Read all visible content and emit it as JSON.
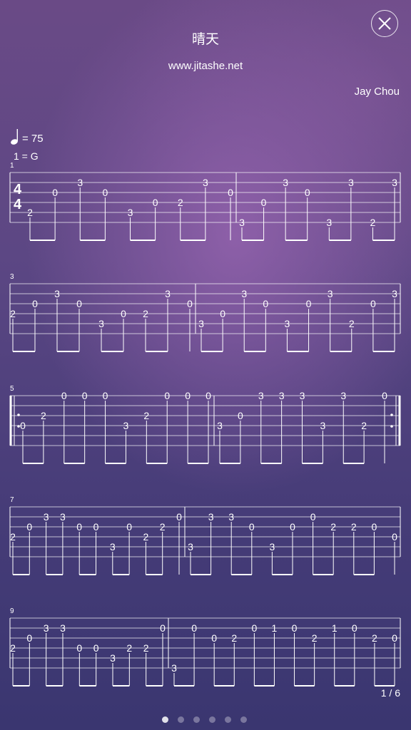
{
  "header": {
    "title": "晴天",
    "website": "www.jitashe.net",
    "artist": "Jay Chou",
    "close_icon": "close-icon"
  },
  "tempo": {
    "note_icon": "quarter-note-icon",
    "text": "= 75"
  },
  "key": {
    "text": "1 = G"
  },
  "time_signature": {
    "top": "4",
    "bottom": "4"
  },
  "systems": [
    {
      "label": "1",
      "measures": [
        {
          "notes": [
            {
              "s": 5,
              "f": "2"
            },
            {
              "s": 3,
              "f": "0"
            },
            {
              "s": 2,
              "f": "3"
            },
            {
              "s": 3,
              "f": "0"
            },
            {
              "s": 5,
              "f": "3"
            },
            {
              "s": 4,
              "f": "0"
            },
            {
              "s": 4,
              "f": "2"
            },
            {
              "s": 2,
              "f": "3"
            },
            {
              "s": 3,
              "f": "0"
            }
          ]
        },
        {
          "notes": [
            {
              "s": 6,
              "f": "3"
            },
            {
              "s": 4,
              "f": "0"
            },
            {
              "s": 2,
              "f": "3"
            },
            {
              "s": 3,
              "f": "0"
            },
            {
              "s": 6,
              "f": "3"
            },
            {
              "s": 2,
              "f": "3"
            },
            {
              "s": 6,
              "f": "2"
            },
            {
              "s": 2,
              "f": "3"
            }
          ]
        }
      ]
    },
    {
      "label": "3",
      "measures": [
        {
          "notes": [
            {
              "s": 4,
              "f": "2"
            },
            {
              "s": 3,
              "f": "0"
            },
            {
              "s": 2,
              "f": "3"
            },
            {
              "s": 3,
              "f": "0"
            },
            {
              "s": 5,
              "f": "3"
            },
            {
              "s": 4,
              "f": "0"
            },
            {
              "s": 4,
              "f": "2"
            },
            {
              "s": 2,
              "f": "3"
            },
            {
              "s": 3,
              "f": "0"
            }
          ]
        },
        {
          "notes": [
            {
              "s": 5,
              "f": "3"
            },
            {
              "s": 4,
              "f": "0"
            },
            {
              "s": 2,
              "f": "3"
            },
            {
              "s": 3,
              "f": "0"
            },
            {
              "s": 5,
              "f": "3"
            },
            {
              "s": 3,
              "f": "0"
            },
            {
              "s": 2,
              "f": "3"
            },
            {
              "s": 5,
              "f": "2"
            },
            {
              "s": 3,
              "f": "0"
            },
            {
              "s": 2,
              "f": "3"
            }
          ]
        }
      ]
    },
    {
      "label": "5",
      "measures": [
        {
          "notes": [
            {
              "s": 4,
              "f": "0"
            },
            {
              "s": 3,
              "f": "2"
            },
            {
              "s": 1,
              "f": "0"
            },
            {
              "s": 1,
              "f": "0"
            },
            {
              "s": 1,
              "f": "0"
            },
            {
              "s": 4,
              "f": "3"
            },
            {
              "s": 3,
              "f": "2"
            },
            {
              "s": 1,
              "f": "0"
            },
            {
              "s": 1,
              "f": "0"
            },
            {
              "s": 1,
              "f": "0"
            }
          ]
        },
        {
          "notes": [
            {
              "s": 4,
              "f": "3"
            },
            {
              "s": 3,
              "f": "0"
            },
            {
              "s": 1,
              "f": "3"
            },
            {
              "s": 1,
              "f": "3"
            },
            {
              "s": 1,
              "f": "3"
            },
            {
              "s": 4,
              "f": "3"
            },
            {
              "s": 1,
              "f": "3"
            },
            {
              "s": 4,
              "f": "2"
            },
            {
              "s": 1,
              "f": "0"
            }
          ]
        }
      ]
    },
    {
      "label": "7",
      "measures": [
        {
          "notes": [
            {
              "s": 4,
              "f": "2"
            },
            {
              "s": 3,
              "f": "0"
            },
            {
              "s": 2,
              "f": "3"
            },
            {
              "s": 2,
              "f": "3"
            },
            {
              "s": 3,
              "f": "0"
            },
            {
              "s": 3,
              "f": "0"
            },
            {
              "s": 5,
              "f": "3"
            },
            {
              "s": 3,
              "f": "0"
            },
            {
              "s": 4,
              "f": "2"
            },
            {
              "s": 3,
              "f": "2"
            },
            {
              "s": 2,
              "f": "0"
            }
          ]
        },
        {
          "notes": [
            {
              "s": 5,
              "f": "3"
            },
            {
              "s": 2,
              "f": "3"
            },
            {
              "s": 2,
              "f": "3"
            },
            {
              "s": 3,
              "f": "0"
            },
            {
              "s": 5,
              "f": "3"
            },
            {
              "s": 3,
              "f": "0"
            },
            {
              "s": 2,
              "f": "0"
            },
            {
              "s": 3,
              "f": "2"
            },
            {
              "s": 3,
              "f": "2"
            },
            {
              "s": 3,
              "f": "0"
            },
            {
              "s": 4,
              "f": "0"
            }
          ]
        }
      ]
    },
    {
      "label": "9",
      "measures": [
        {
          "notes": [
            {
              "s": 4,
              "f": "2"
            },
            {
              "s": 3,
              "f": "0"
            },
            {
              "s": 2,
              "f": "3"
            },
            {
              "s": 2,
              "f": "3"
            },
            {
              "s": 4,
              "f": "0"
            },
            {
              "s": 4,
              "f": "0"
            },
            {
              "s": 5,
              "f": "3"
            },
            {
              "s": 4,
              "f": "2"
            },
            {
              "s": 4,
              "f": "2"
            },
            {
              "s": 2,
              "f": "0"
            }
          ]
        },
        {
          "notes": [
            {
              "s": 6,
              "f": "3"
            },
            {
              "s": 2,
              "f": "0"
            },
            {
              "s": 3,
              "f": "0"
            },
            {
              "s": 3,
              "f": "2"
            },
            {
              "s": 2,
              "f": "0"
            },
            {
              "s": 2,
              "f": "1"
            },
            {
              "s": 2,
              "f": "0"
            },
            {
              "s": 3,
              "f": "2"
            },
            {
              "s": 2,
              "f": "1"
            },
            {
              "s": 2,
              "f": "0"
            },
            {
              "s": 3,
              "f": "2"
            },
            {
              "s": 3,
              "f": "0"
            }
          ]
        }
      ]
    }
  ],
  "pagination": {
    "text": "1 / 6",
    "current": 1,
    "total": 6
  }
}
